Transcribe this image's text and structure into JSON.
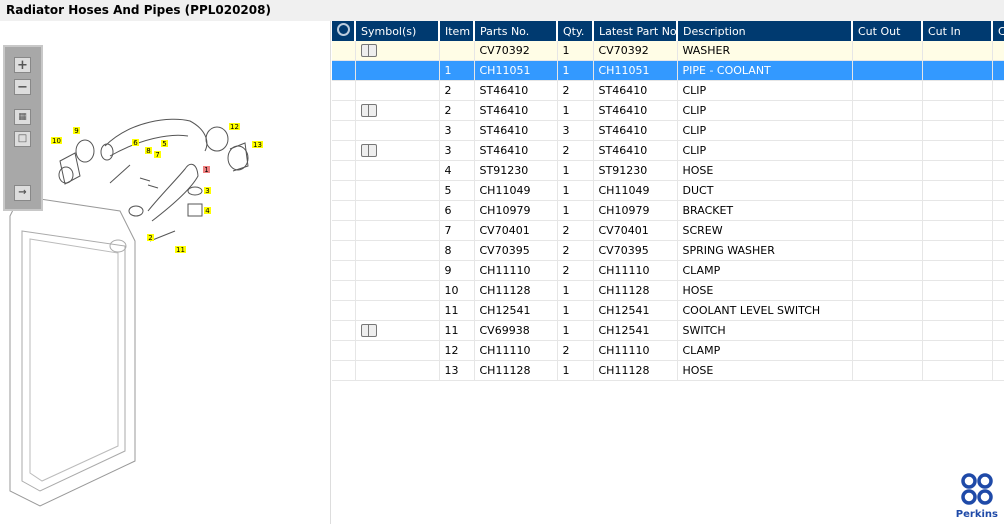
{
  "title": "Radiator Hoses And Pipes (PPL020208)",
  "toolbar": {
    "zoom_in": "+",
    "zoom_out": "−"
  },
  "diagram": {
    "callouts": [
      "1",
      "2",
      "3",
      "4",
      "5",
      "6",
      "7",
      "8",
      "9",
      "10",
      "11",
      "12",
      "13"
    ],
    "highlighted": "1"
  },
  "columns": [
    "Symbol(s)",
    "Item",
    "Parts No.",
    "Qty.",
    "Latest Part No.",
    "Description",
    "Cut Out",
    "Cut In",
    "C"
  ],
  "rows": [
    {
      "sym": true,
      "item": "",
      "part": "CV70392",
      "qty": "1",
      "latest": "CV70392",
      "desc": "WASHER",
      "state": "hl"
    },
    {
      "sym": false,
      "item": "1",
      "part": "CH11051",
      "qty": "1",
      "latest": "CH11051",
      "desc": "PIPE - COOLANT",
      "state": "sel"
    },
    {
      "sym": false,
      "item": "2",
      "part": "ST46410",
      "qty": "2",
      "latest": "ST46410",
      "desc": "CLIP"
    },
    {
      "sym": true,
      "item": "2",
      "part": "ST46410",
      "qty": "1",
      "latest": "ST46410",
      "desc": "CLIP"
    },
    {
      "sym": false,
      "item": "3",
      "part": "ST46410",
      "qty": "3",
      "latest": "ST46410",
      "desc": "CLIP"
    },
    {
      "sym": true,
      "item": "3",
      "part": "ST46410",
      "qty": "2",
      "latest": "ST46410",
      "desc": "CLIP"
    },
    {
      "sym": false,
      "item": "4",
      "part": "ST91230",
      "qty": "1",
      "latest": "ST91230",
      "desc": "HOSE"
    },
    {
      "sym": false,
      "item": "5",
      "part": "CH11049",
      "qty": "1",
      "latest": "CH11049",
      "desc": "DUCT"
    },
    {
      "sym": false,
      "item": "6",
      "part": "CH10979",
      "qty": "1",
      "latest": "CH10979",
      "desc": "BRACKET"
    },
    {
      "sym": false,
      "item": "7",
      "part": "CV70401",
      "qty": "2",
      "latest": "CV70401",
      "desc": "SCREW"
    },
    {
      "sym": false,
      "item": "8",
      "part": "CV70395",
      "qty": "2",
      "latest": "CV70395",
      "desc": "SPRING WASHER"
    },
    {
      "sym": false,
      "item": "9",
      "part": "CH11110",
      "qty": "2",
      "latest": "CH11110",
      "desc": "CLAMP"
    },
    {
      "sym": false,
      "item": "10",
      "part": "CH11128",
      "qty": "1",
      "latest": "CH11128",
      "desc": "HOSE"
    },
    {
      "sym": false,
      "item": "11",
      "part": "CH12541",
      "qty": "1",
      "latest": "CH12541",
      "desc": "COOLANT LEVEL SWITCH"
    },
    {
      "sym": true,
      "item": "11",
      "part": "CV69938",
      "qty": "1",
      "latest": "CH12541",
      "desc": "SWITCH"
    },
    {
      "sym": false,
      "item": "12",
      "part": "CH11110",
      "qty": "2",
      "latest": "CH11110",
      "desc": "CLAMP"
    },
    {
      "sym": false,
      "item": "13",
      "part": "CH11128",
      "qty": "1",
      "latest": "CH11128",
      "desc": "HOSE"
    }
  ],
  "brand": "Perkins",
  "colors": {
    "header": "#003a70",
    "selected": "#3399ff",
    "highlight": "#fffde6",
    "callout": "#ffff00"
  }
}
